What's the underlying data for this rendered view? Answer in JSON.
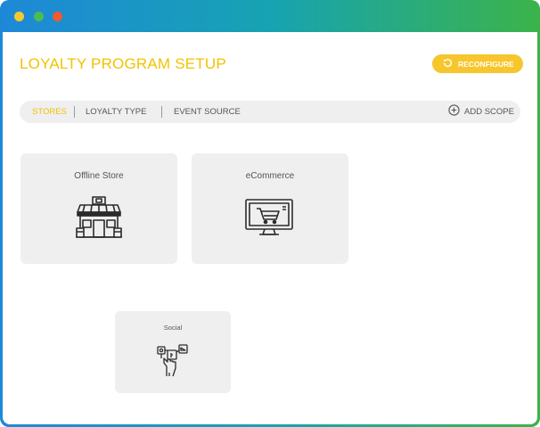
{
  "window": {
    "controls": [
      "close",
      "minimize",
      "maximize"
    ]
  },
  "header": {
    "title": "LOYALTY PROGRAM SETUP",
    "reconfigure_label": "RECONFIGURE",
    "reconfigure_icon": "refresh-icon"
  },
  "tabs": {
    "items": [
      {
        "label": "STORES",
        "active": true
      },
      {
        "label": "LOYALTY TYPE",
        "active": false
      },
      {
        "label": "EVENT SOURCE",
        "active": false
      }
    ],
    "add_scope_label": "ADD SCOPE",
    "add_scope_icon": "plus-circle-icon"
  },
  "cards": [
    {
      "label": "Offline Store",
      "icon": "storefront-icon"
    },
    {
      "label": "eCommerce",
      "icon": "monitor-cart-icon"
    },
    {
      "label": "Social",
      "icon": "hand-social-icon"
    }
  ],
  "colors": {
    "accent": "#f2c200",
    "button": "#f6c62c",
    "card_bg": "#efefef",
    "frame_gradient": [
      "#1e88d8",
      "#3bb34a"
    ]
  }
}
